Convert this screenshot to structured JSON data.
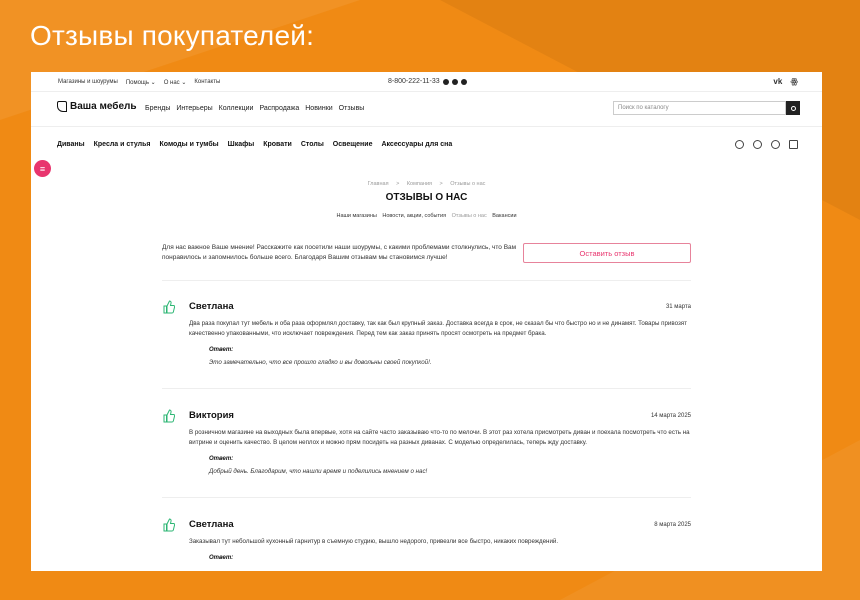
{
  "banner": {
    "title": "Отзывы покупателей:"
  },
  "topbar": {
    "links": [
      "Магазины и шоурумы",
      "Помощь ⌄",
      "О нас ⌄",
      "Контакты"
    ],
    "phone": "8-800-222-11-33",
    "social": [
      "vk-icon",
      "ok-icon"
    ]
  },
  "header": {
    "logo": "Ваша мебель",
    "nav": [
      "Бренды",
      "Интерьеры",
      "Коллекции",
      "Распродажа",
      "Новинки",
      "Отзывы"
    ],
    "search_placeholder": "Поиск по каталогу"
  },
  "catalog": {
    "items": [
      "Диваны",
      "Кресла и стулья",
      "Комоды и тумбы",
      "Шкафы",
      "Кровати",
      "Столы",
      "Освещение",
      "Аксессуары для сна"
    ]
  },
  "breadcrumbs": [
    "Главная",
    ">",
    "Компания",
    ">",
    "Отзывы о нас"
  ],
  "page": {
    "title": "ОТЗЫВЫ О НАС",
    "subnav": [
      "Наши магазины",
      "Новости, акции, события",
      "Отзывы о нас",
      "Вакансии"
    ],
    "intro": "Для нас важное Ваше мнение! Расскажите как посетили наши шоурумы, с какими проблемами столкнулись, что Вам понравилось и запомнилось больше всего. Благодаря Вашим отзывам мы становимся лучше!",
    "leave_review": "Оставить отзыв"
  },
  "reviews": [
    {
      "name": "Светлана",
      "date": "31 марта",
      "text": "Два раза покупал тут мебель и оба раза оформлял доставку, так как был крупный заказ. Доставка всегда в срок, не сказал бы что быстро но и не динамят. Товары привозят качественно упакованными, что исключает повреждения. Перед тем как заказ принять просят осмотреть на предмет брака.",
      "answer_label": "Ответ:",
      "answer": "Это замечательно, что все прошло гладко и вы довольны своей покупкой!."
    },
    {
      "name": "Виктория",
      "date": "14 марта 2025",
      "text": "В розничном магазине на выходных была впервые, хотя на сайте часто заказываю что-то по мелочи. В этот раз хотела присмотреть диван и поехала посмотреть что есть на витрине и оценить качество. В целом неплох и можно прям посидеть на разных диванах. С моделью определилась, теперь жду доставку.",
      "answer_label": "Ответ:",
      "answer": "Добрый день. Благодарим, что нашли время и поделились мнением о нас!"
    },
    {
      "name": "Светлана",
      "date": "8 марта 2025",
      "text": "Заказывал тут небольшой кухонный гарнитур в съемную студию, вышло недорого, привезли все быстро, никаких повреждений.",
      "answer_label": "Ответ:",
      "answer": ""
    }
  ],
  "colors": {
    "accent": "#e8356e",
    "banner_bg": "#f08a14",
    "thumb": "#2bb673"
  }
}
